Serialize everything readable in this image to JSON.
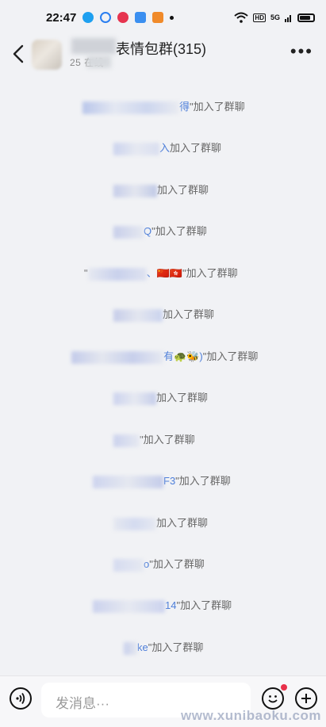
{
  "status_bar": {
    "time": "22:47",
    "icons": [
      "qq-icon",
      "circle-icon",
      "red-app-icon",
      "blue-app-icon",
      "orange-app-icon",
      "dot-icon"
    ],
    "right": {
      "wifi": "wifi-icon",
      "hd": "HD",
      "signal_label": "5G",
      "battery": "battery-icon"
    }
  },
  "header": {
    "back_icon": "chevron-left-icon",
    "title": "表情包群(315)",
    "subtitle": "25  在线",
    "more_icon": "more-dots-icon"
  },
  "messages": [
    {
      "nick": "得",
      "suffix": "\"加入了群聊"
    },
    {
      "nick": "入",
      "suffix": "加入了群聊"
    },
    {
      "nick": "",
      "suffix": "加入了群聊"
    },
    {
      "nick": "Q",
      "suffix": "\"加入了群聊"
    },
    {
      "nick": "\"",
      "extra": "、🇨🇳🇭🇰",
      "suffix": "\"加入了群聊"
    },
    {
      "nick": "",
      "suffix": "加入了群聊"
    },
    {
      "nick": "有🐢🐝)",
      "suffix": "\"加入了群聊"
    },
    {
      "nick": "",
      "suffix": "加入了群聊"
    },
    {
      "nick": "",
      "suffix": "\"加入了群聊"
    },
    {
      "nick": "F3",
      "suffix": "\"加入了群聊"
    },
    {
      "nick": "",
      "suffix": "加入了群聊"
    },
    {
      "nick": "o",
      "suffix": "\"加入了群聊"
    },
    {
      "nick": "14",
      "suffix": "\"加入了群聊"
    },
    {
      "nick": "ke",
      "suffix": "\"加入了群聊"
    }
  ],
  "input_bar": {
    "voice_icon": "voice-icon",
    "placeholder": "发消息···",
    "emoji_icon": "emoji-icon",
    "plus_icon": "plus-icon"
  },
  "watermark": "www.xunibaoku.com",
  "colors": {
    "nick_blue": "#4d7ed9",
    "badge_red": "#e8304a",
    "background": "#f1f2f5"
  }
}
